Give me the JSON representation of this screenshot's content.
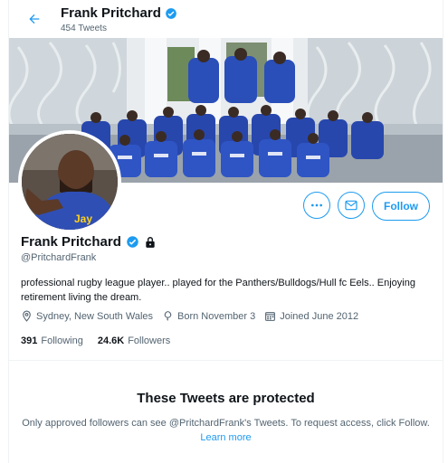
{
  "header": {
    "name": "Frank Pritchard",
    "tweet_count": "454 Tweets"
  },
  "profile": {
    "name": "Frank Pritchard",
    "handle": "@PritchardFrank",
    "bio": "professional rugby league player.. played for the Panthers/Bulldogs/Hull fc Eels.. Enjoying retirement living the dream.",
    "location": "Sydney, New South Wales",
    "birthday": "Born November 3",
    "joined": "Joined June 2012",
    "following_count": "391",
    "following_label": "Following",
    "followers_count": "24.6K",
    "followers_label": "Followers",
    "verified": true,
    "protected": true
  },
  "actions": {
    "follow_label": "Follow"
  },
  "protected_notice": {
    "title": "These Tweets are protected",
    "text": "Only approved followers can see @PritchardFrank's Tweets. To request access, click Follow.",
    "learn_more": "Learn more"
  },
  "colors": {
    "accent": "#1d9bf0",
    "text": "#0f1419",
    "secondary": "#536471",
    "team_blue": "#2a4fb8"
  },
  "icons": [
    "back-arrow-icon",
    "verified-badge-icon",
    "lock-icon",
    "more-icon",
    "mail-icon",
    "location-icon",
    "birthday-icon",
    "calendar-icon"
  ]
}
